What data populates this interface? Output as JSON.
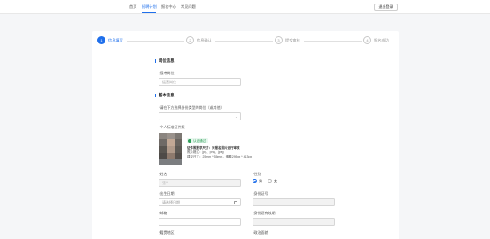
{
  "nav": {
    "items": [
      {
        "label": "首页"
      },
      {
        "label": "招聘计划"
      },
      {
        "label": "报名中心"
      },
      {
        "label": "常见问题"
      }
    ],
    "exit_label": "退出登录"
  },
  "steps": [
    {
      "number": "1",
      "label": "信息填写"
    },
    {
      "number": "2",
      "label": "信息确认"
    },
    {
      "number": "3",
      "label": "提交审核"
    },
    {
      "number": "4",
      "label": "报名成功"
    }
  ],
  "sections": {
    "position": "岗位信息",
    "basic": "基本信息"
  },
  "form": {
    "position": {
      "label": "*报考岗位",
      "value": "运营岗位"
    },
    "id_upload": {
      "label": "*请在下方选择身份类型的岗位（或其他）",
      "placeholder": ""
    },
    "photo": {
      "label": "*个人标准证件照",
      "tag": "认证通过",
      "req_title": "证件照要求尺寸：对报名照片进行审核",
      "req_line1": "照片格式：jpg、png、jpeg",
      "req_line2": "建议尺寸：25mm * 35mm，像素295px * 413px"
    },
    "name": {
      "label": "*姓名",
      "value": "张**"
    },
    "gender": {
      "label": "*性别",
      "options": [
        "男",
        "女"
      ],
      "selected": "男"
    },
    "birth": {
      "label": "*出生日期",
      "placeholder": "请选择日期"
    },
    "id_number": {
      "label": "*身份证号",
      "value": ""
    },
    "email": {
      "label": "*邮箱",
      "value": ""
    },
    "id_valid": {
      "label": "*身份证有效期",
      "value": ""
    },
    "field_a": {
      "label": "*籍贯地区"
    },
    "field_b": {
      "label": "*政治面貌"
    }
  },
  "colors": {
    "accent": "#1f6feb",
    "success": "#2e9e58"
  }
}
